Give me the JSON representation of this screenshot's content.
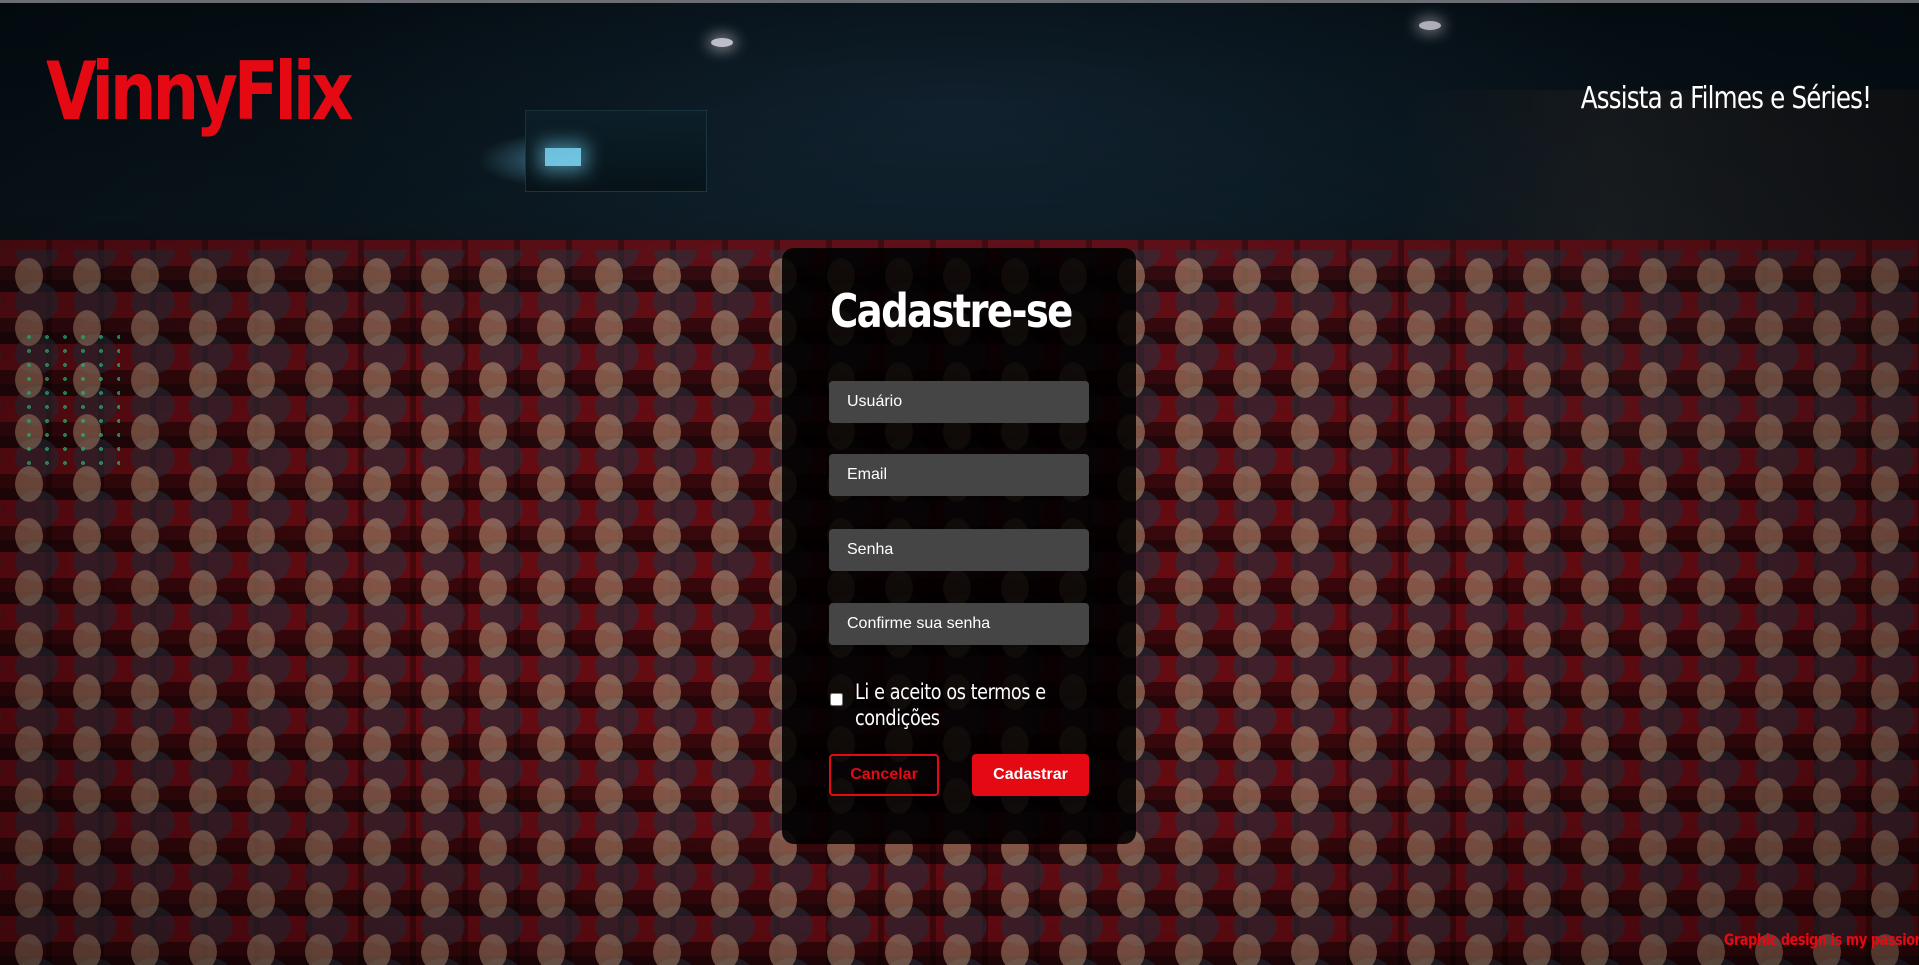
{
  "header": {
    "logo": "VinnyFlix",
    "tagline": "Assista a Filmes e Séries!"
  },
  "form": {
    "title": "Cadastre-se",
    "fields": {
      "username_placeholder": "Usuário",
      "email_placeholder": "Email",
      "password_placeholder": "Senha",
      "confirm_placeholder": "Confirme sua senha"
    },
    "terms_label": "Li e aceito os termos e condições",
    "terms_checked": false,
    "cancel_label": "Cancelar",
    "submit_label": "Cadastrar"
  },
  "footer": {
    "credit": "Graphic design is my passion"
  },
  "colors": {
    "brand_red": "#e50914",
    "card_bg": "#000000",
    "input_bg": "#454545",
    "text": "#ffffff"
  },
  "icons": {
    "background": "cinema-audience-photo"
  }
}
